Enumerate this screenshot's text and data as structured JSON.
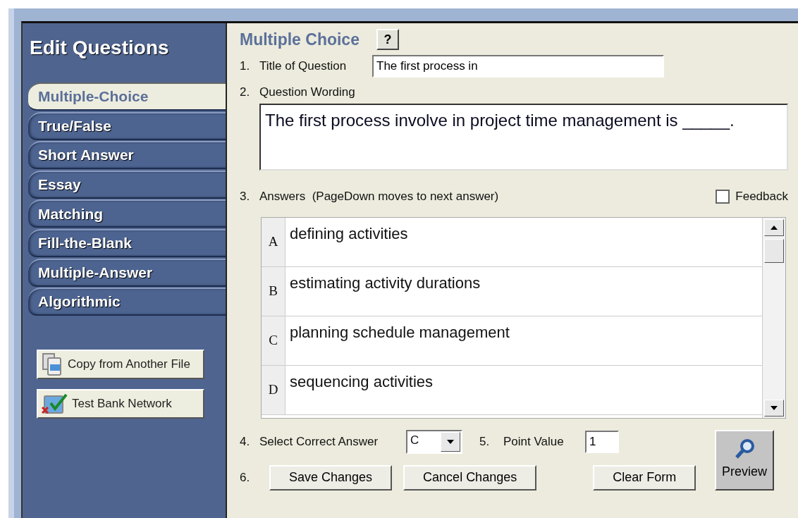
{
  "sidebar": {
    "title": "Edit Questions",
    "tabs": [
      {
        "label": "Multiple-Choice",
        "selected": true
      },
      {
        "label": "True/False",
        "selected": false
      },
      {
        "label": "Short Answer",
        "selected": false
      },
      {
        "label": "Essay",
        "selected": false
      },
      {
        "label": "Matching",
        "selected": false
      },
      {
        "label": "Fill-the-Blank",
        "selected": false
      },
      {
        "label": "Multiple-Answer",
        "selected": false
      },
      {
        "label": "Algorithmic",
        "selected": false
      }
    ],
    "buttons": [
      {
        "label": "Copy from Another File",
        "kind": "copy"
      },
      {
        "label": "Test Bank Network",
        "kind": "network"
      }
    ]
  },
  "form": {
    "heading": "Multiple Choice",
    "help_button": "?",
    "title_field": {
      "number": "1.",
      "label": "Title of Question",
      "value": "The first process in"
    },
    "wording": {
      "number": "2.",
      "label": "Question Wording",
      "value": "The first process involve in project time management is _____."
    },
    "answers": {
      "number": "3.",
      "label": "Answers  (PageDown moves to next answer)",
      "feedback": {
        "label": "Feedback",
        "checked": false
      },
      "rows": [
        {
          "letter": "A",
          "text": "defining activities"
        },
        {
          "letter": "B",
          "text": "estimating activity durations"
        },
        {
          "letter": "C",
          "text": "planning schedule management"
        },
        {
          "letter": "D",
          "text": "sequencing activities"
        }
      ]
    },
    "correct": {
      "number": "4.",
      "label": "Select Correct Answer",
      "value": "C"
    },
    "points": {
      "number": "5.",
      "label": "Point Value",
      "value": "1"
    },
    "actions": {
      "number": "6.",
      "buttons": [
        "Save Changes",
        "Cancel Changes",
        "Clear Form"
      ]
    },
    "preview": "Preview"
  }
}
